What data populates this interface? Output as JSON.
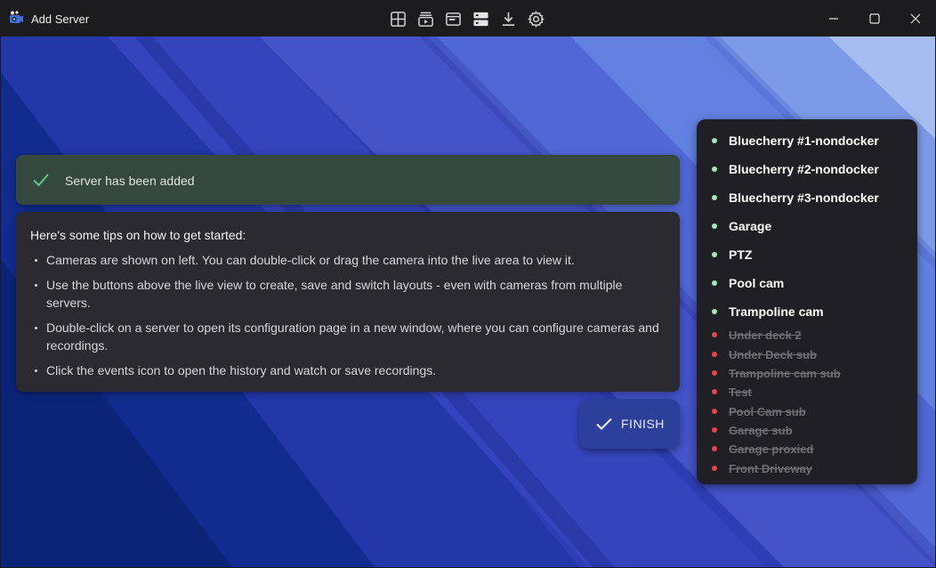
{
  "window": {
    "title": "Add Server"
  },
  "toolbar": {
    "icons": [
      "grid-layout-icon",
      "live-view-icon",
      "window-icon",
      "servers-icon",
      "download-icon",
      "settings-icon"
    ]
  },
  "notification": {
    "message": "Server has been added"
  },
  "tips": {
    "heading": "Here's some tips on how to get started:",
    "items": [
      "Cameras are shown on left. You can double-click or drag the camera into the live area to view it.",
      "Use the buttons above the live view to create, save and switch layouts - even with cameras from multiple servers.",
      "Double-click on a server to open its configuration page in a new window, where you can configure cameras and recordings.",
      "Click the events icon to open the history and watch or save recordings."
    ]
  },
  "finish": {
    "label": "FINISH"
  },
  "servers": {
    "online": [
      "Bluecherry #1-nondocker",
      "Bluecherry #2-nondocker",
      "Bluecherry #3-nondocker",
      "Garage",
      "PTZ",
      "Pool cam",
      "Trampoline cam"
    ],
    "offline": [
      "Under deck 2",
      "Under Deck sub",
      "Trampoline cam sub",
      "Test",
      "Pool Cam sub",
      "Garage sub",
      "Garage proxied",
      "Front Driveway"
    ],
    "online_color": "#a6e6b7",
    "offline_color": "#e24848"
  },
  "colors": {
    "titlebar": "#1c1c1f",
    "success_bg": "#34483c",
    "success_check": "#5ec98a",
    "card_bg": "#2a2a30",
    "finish_bg": "#2c3f9a"
  }
}
